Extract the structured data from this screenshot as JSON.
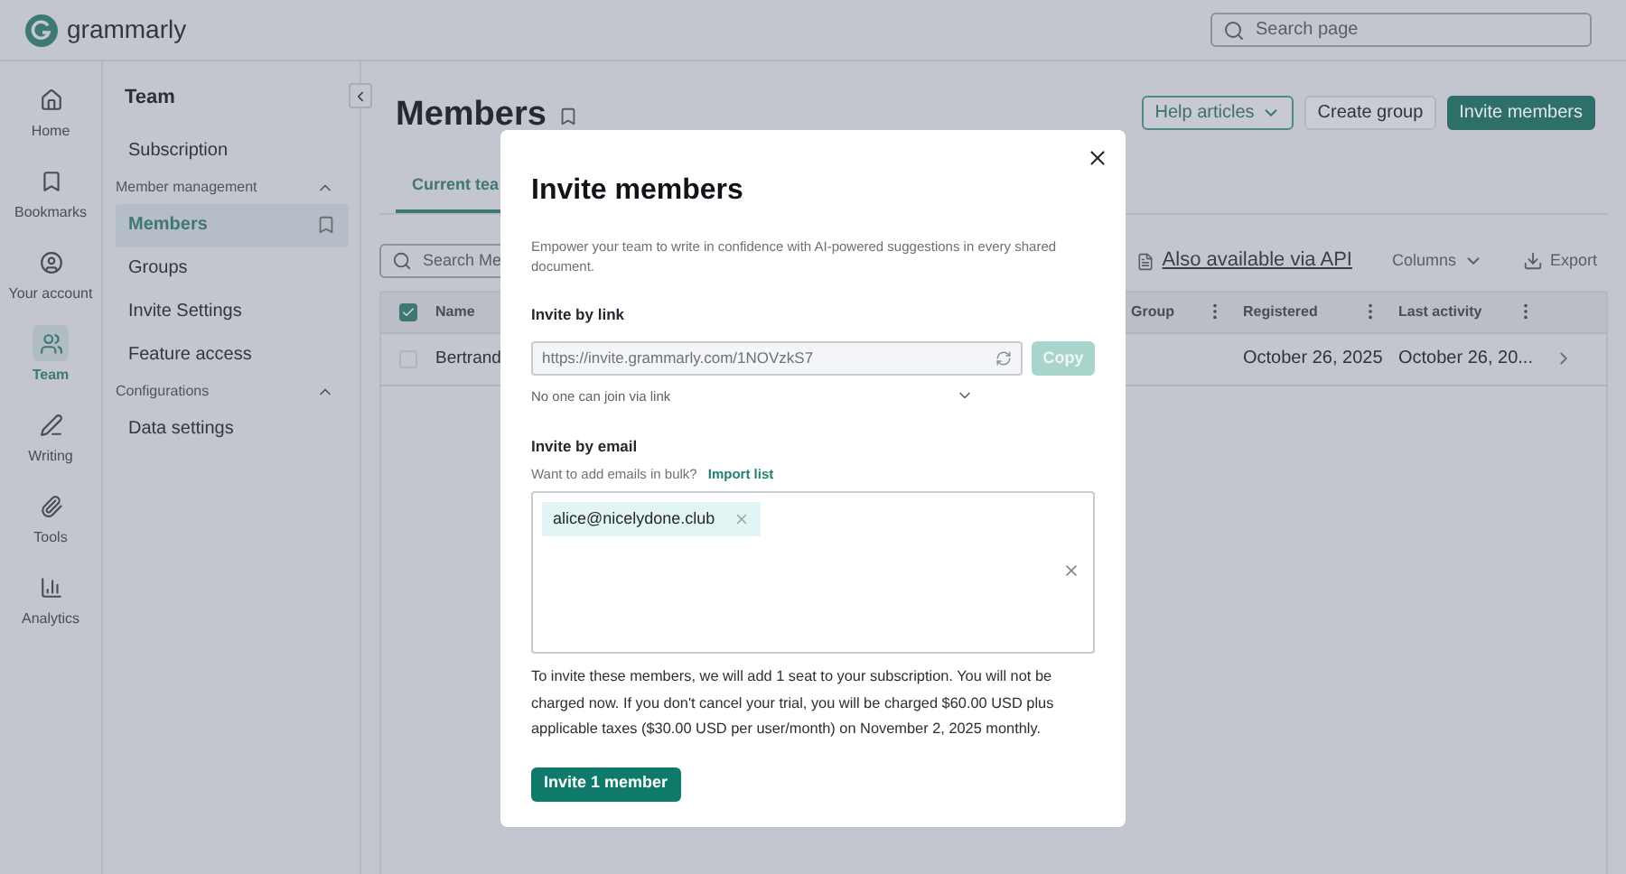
{
  "app": {
    "name": "grammarly"
  },
  "search": {
    "placeholder": "Search page"
  },
  "nav_rail": [
    {
      "label": "Home",
      "selected": false
    },
    {
      "label": "Bookmarks",
      "selected": false
    },
    {
      "label": "Your account",
      "selected": false
    },
    {
      "label": "Team",
      "selected": true
    },
    {
      "label": "Writing",
      "selected": false
    },
    {
      "label": "Tools",
      "selected": false
    },
    {
      "label": "Analytics",
      "selected": false
    }
  ],
  "sidebar": {
    "title": "Team",
    "items": [
      {
        "kind": "link",
        "label": "Subscription",
        "selected": false
      },
      {
        "kind": "section",
        "label": "Member management",
        "expanded": true
      },
      {
        "kind": "link",
        "label": "Members",
        "selected": true
      },
      {
        "kind": "link",
        "label": "Groups",
        "selected": false
      },
      {
        "kind": "link",
        "label": "Invite Settings",
        "selected": false
      },
      {
        "kind": "link",
        "label": "Feature access",
        "selected": false
      },
      {
        "kind": "section",
        "label": "Configurations",
        "expanded": true
      },
      {
        "kind": "link",
        "label": "Data settings",
        "selected": false
      }
    ]
  },
  "page": {
    "title": "Members",
    "buttons": [
      {
        "label": "Help articles",
        "kind": "outline"
      },
      {
        "label": "Create group",
        "kind": "plain"
      },
      {
        "label": "Invite members",
        "kind": "primary"
      }
    ],
    "tabs": [
      {
        "label": "Current tea",
        "selected": true
      }
    ],
    "search_placeholder": "Search Me",
    "api_link": "Also available via API",
    "columns_button": "Columns",
    "export_button": "Export"
  },
  "table": {
    "all_checked": true,
    "columns": [
      {
        "label": "Name"
      },
      {
        "label": "Group"
      },
      {
        "label": "Registered"
      },
      {
        "label": "Last activity"
      }
    ],
    "rows": [
      {
        "checked": false,
        "name": "Bertrand",
        "registered": "October 26, 2025",
        "last_activity": "October 26, 20..."
      }
    ]
  },
  "dialog": {
    "title": "Invite members",
    "description": "Empower your team to write in confidence with AI-powered suggestions in every shared document.",
    "link_label": "Invite by link",
    "link_url": "https://invite.grammarly.com/1NOVzkS7",
    "copy_button": "Copy",
    "copy_disabled": true,
    "link_access": "No one can join via link",
    "email_label": "Invite by email",
    "email_hint": "Want to add emails in bulk?",
    "import_link": "Import list",
    "chips": [
      {
        "email": "alice@nicelydone.club"
      }
    ],
    "notice": "To invite these members, we will add 1 seat to your subscription. You will not be charged now. If you don't cancel your trial, you will be charged $60.00 USD plus applicable taxes ($30.00 USD per user/month) on November 2, 2025 monthly.",
    "submit": "Invite 1 member"
  }
}
